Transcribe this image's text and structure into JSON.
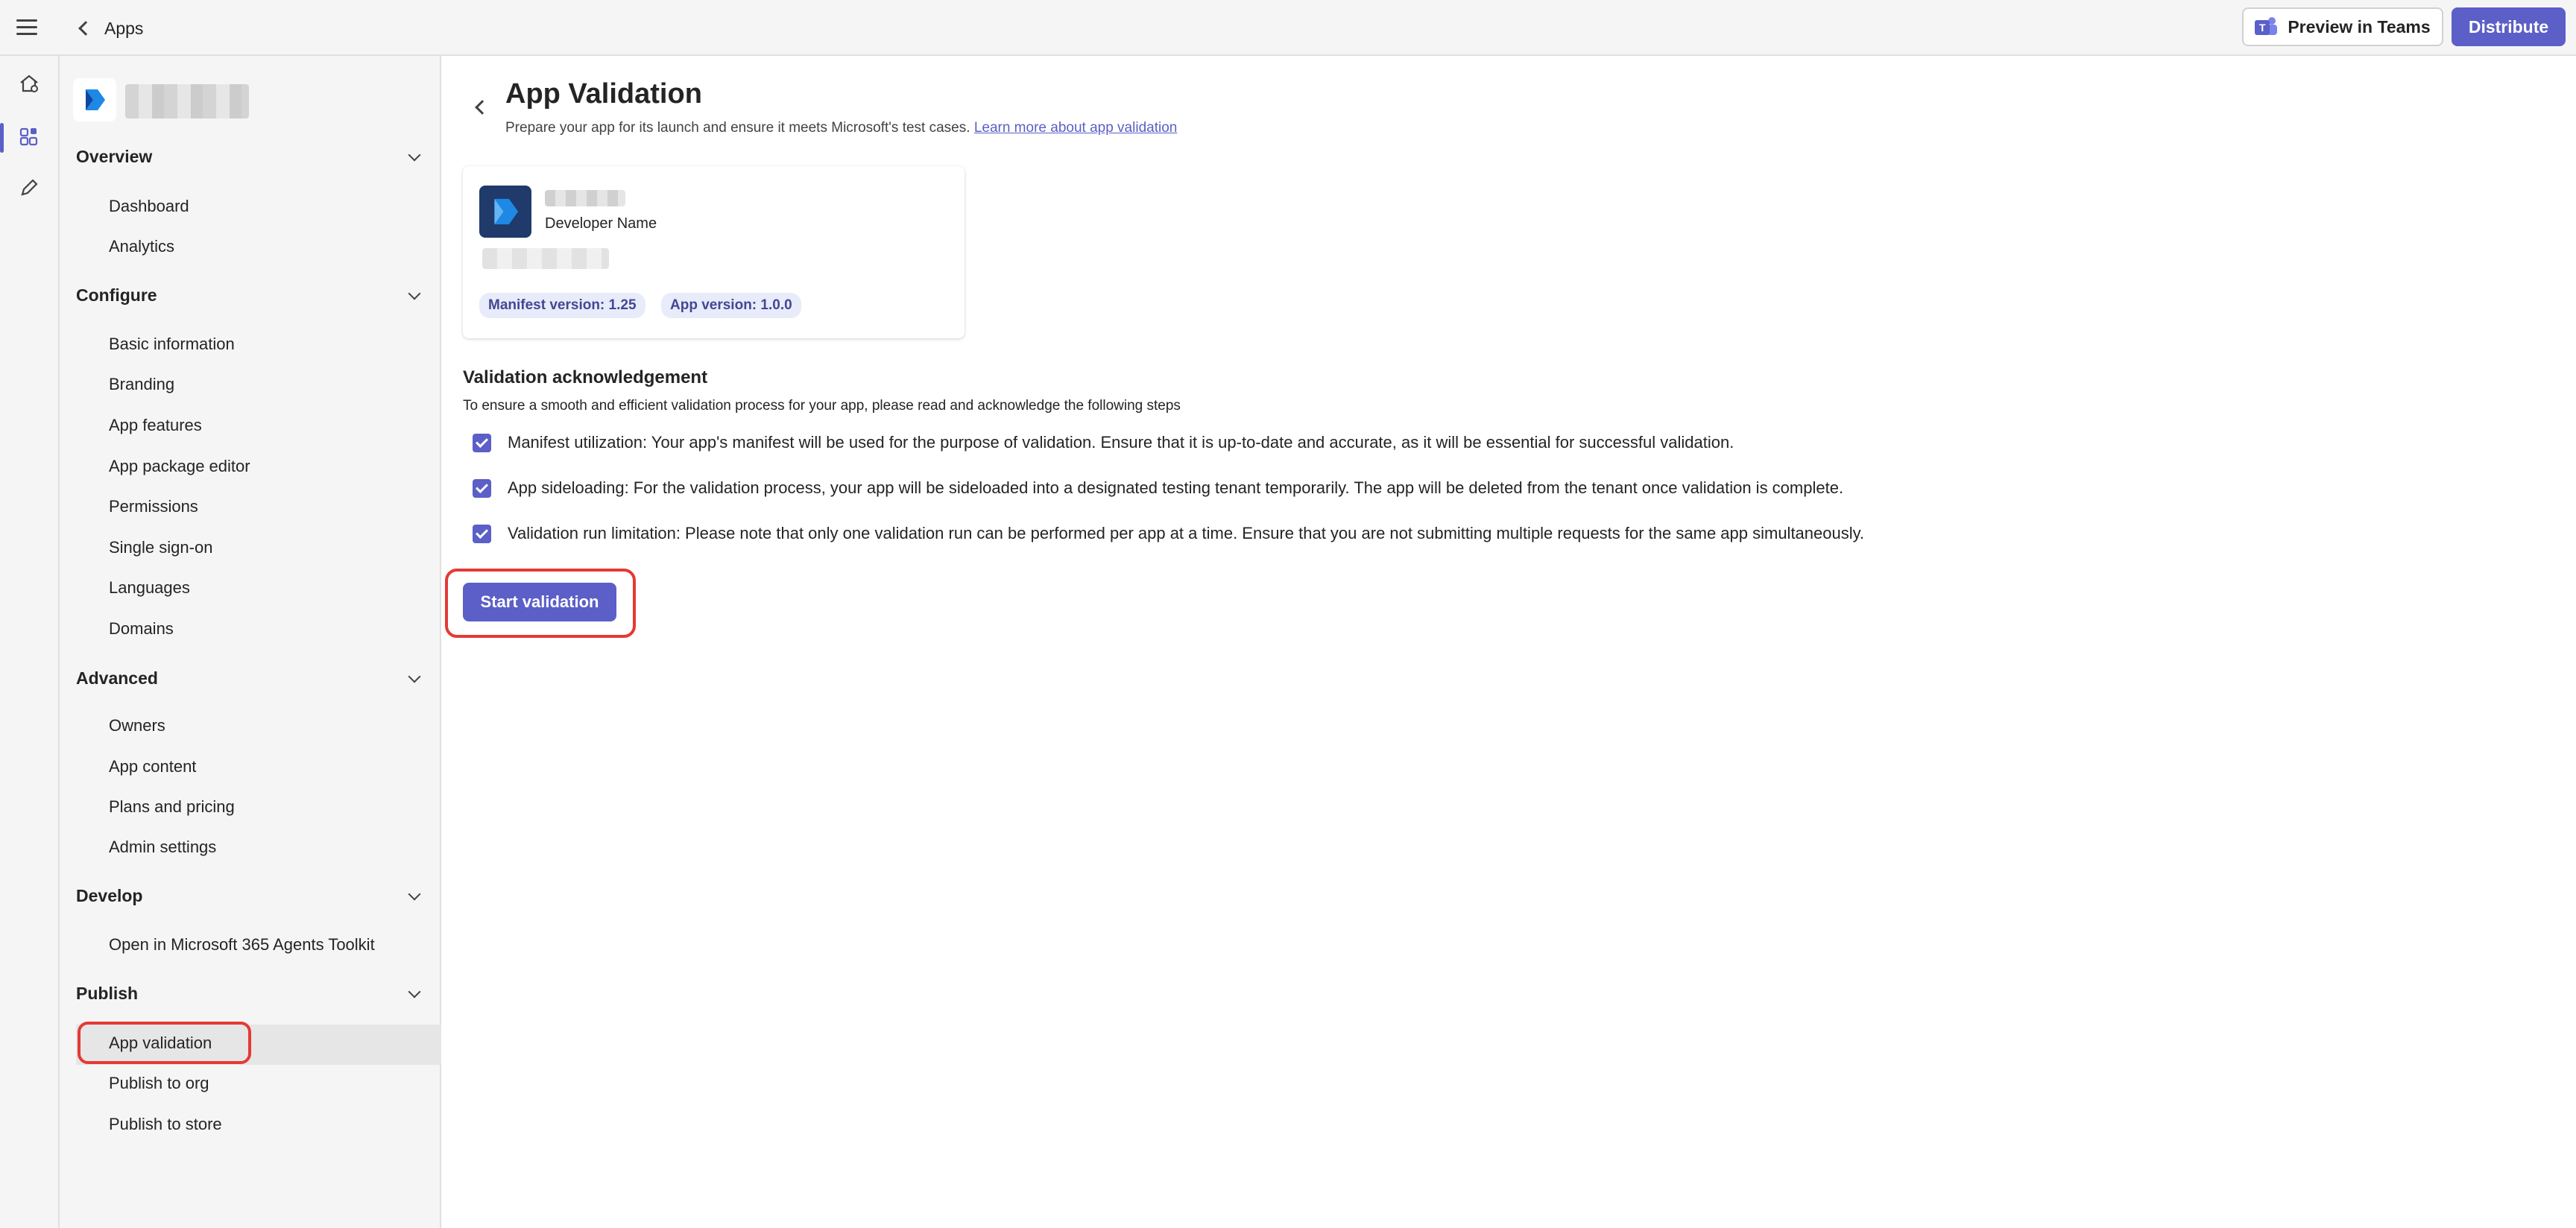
{
  "topbar": {
    "back_label": "Apps",
    "preview_label": "Preview in Teams",
    "distribute_label": "Distribute"
  },
  "sidebar": {
    "sections": [
      {
        "title": "Overview",
        "items": [
          "Dashboard",
          "Analytics"
        ]
      },
      {
        "title": "Configure",
        "items": [
          "Basic information",
          "Branding",
          "App features",
          "App package editor",
          "Permissions",
          "Single sign-on",
          "Languages",
          "Domains"
        ]
      },
      {
        "title": "Advanced",
        "items": [
          "Owners",
          "App content",
          "Plans and pricing",
          "Admin settings"
        ]
      },
      {
        "title": "Develop",
        "items": [
          "Open in Microsoft 365 Agents Toolkit"
        ]
      },
      {
        "title": "Publish",
        "items": [
          "App validation",
          "Publish to org",
          "Publish to store"
        ]
      }
    ],
    "selected_item": "App validation"
  },
  "page": {
    "title": "App Validation",
    "subtitle": "Prepare your app for its launch and ensure it meets Microsoft's test cases.",
    "learn_more": "Learn more about app validation"
  },
  "app_card": {
    "developer_label": "Developer Name",
    "manifest_badge": "Manifest version: 1.25",
    "app_version_badge": "App version: 1.0.0"
  },
  "acknowledgement": {
    "title": "Validation acknowledgement",
    "description": "To ensure a smooth and efficient validation process for your app, please read and acknowledge the following steps",
    "items": [
      "Manifest utilization: Your app's manifest will be used for the purpose of validation. Ensure that it is up-to-date and accurate, as it will be essential for successful validation.",
      "App sideloading: For the validation process, your app will be sideloaded into a designated testing tenant temporarily. The app will be deleted from the tenant once validation is complete.",
      "Validation run limitation: Please note that only one validation run can be performed per app at a time. Ensure that you are not submitting multiple requests for the same app simultaneously."
    ]
  },
  "start_button_label": "Start validation",
  "colors": {
    "accent": "#5b5fc7",
    "highlight_outline": "#e53935"
  }
}
